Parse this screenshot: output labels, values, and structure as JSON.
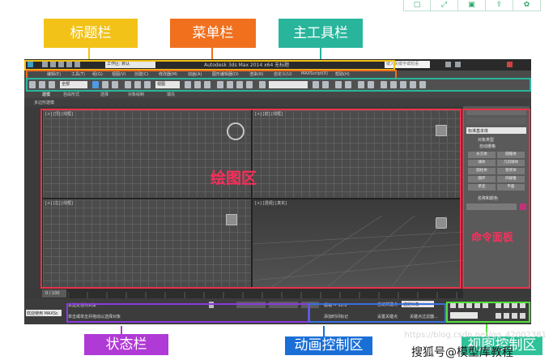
{
  "callouts": {
    "title_bar": "标题栏",
    "menu_bar": "菜单栏",
    "main_toolbar": "主工具栏",
    "status_bar": "状态栏",
    "anim_control": "动画控制区",
    "nav_control": "视图控制区"
  },
  "zones": {
    "drawing_area": "绘图区",
    "command_panel": "命令面板"
  },
  "app": {
    "title": "Autodesk 3ds Max 2014 x64    无标题",
    "workspace": "工作区: 默认",
    "search_placeholder": "键入关键字或短语",
    "menus": [
      "编辑(E)",
      "工具(T)",
      "组(G)",
      "视图(V)",
      "创建(C)",
      "修改器(M)",
      "动画(A)",
      "图形编辑器(D)",
      "渲染(R)",
      "自定义(U)",
      "MAXScript(X)",
      "帮助(H)"
    ],
    "toolbar_select": "全部",
    "toolbar_view": "视图",
    "ribbon_tabs": [
      "建模",
      "自由形式",
      "选择",
      "对象绘制",
      "填充"
    ],
    "sub_ribbon": "多边形建模",
    "viewports": [
      "[+] [顶] [线框]",
      "[+] [前] [线框]",
      "[+] [左] [线框]",
      "[+] [透视] [真实]"
    ],
    "cmd_dropdown": "标准基本体",
    "cmd_section_type": "对象类型",
    "cmd_autogrid": "自动栅格",
    "cmd_buttons": [
      "长方体",
      "圆锥体",
      "球体",
      "几何球体",
      "圆柱体",
      "管状体",
      "圆环",
      "四棱锥",
      "茶壶",
      "平面"
    ],
    "cmd_section_name": "名称和颜色",
    "status_select": "未选定任何对象",
    "status_hint": "单击或单击并拖动以选择对象",
    "status_welcome": "欢迎使用 MAXSc",
    "grid_text": "栅格 = 10.0",
    "auto_key": "自动关键点",
    "set_key": "设置关键点",
    "selected_obj": "选定对象",
    "key_filter": "关键点过滤器...",
    "add_time_tag": "添加时间标记",
    "timeline_range": "0 / 100"
  },
  "share_icons": [
    "file-icon",
    "expand-icon",
    "save-icon",
    "share-icon",
    "settings-icon"
  ],
  "watermark": "https://blog.csdn.net/qq_42002381",
  "bottom_garble": "搜狐号@模型库教程"
}
